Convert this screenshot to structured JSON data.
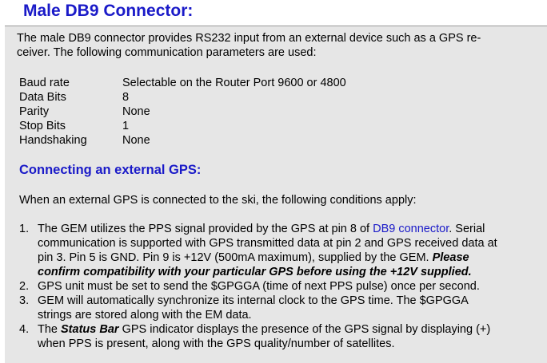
{
  "title": "Male DB9 Connector:",
  "intro": {
    "line1": "The male DB9 connector provides RS232 input from an external device such as a GPS re-",
    "line2": "ceiver. The following communication parameters are used:"
  },
  "parameters": [
    {
      "name": "Baud rate",
      "value": "Selectable on the Router Port 9600 or 4800"
    },
    {
      "name": "Data Bits",
      "value": "8"
    },
    {
      "name": "Parity",
      "value": "None"
    },
    {
      "name": "Stop Bits",
      "value": "1"
    },
    {
      "name": "Handshaking",
      "value": "None"
    }
  ],
  "section": {
    "heading": "Connecting an external GPS:",
    "conditions": "When an external GPS is connected to the ski, the following conditions apply:"
  },
  "items": [
    {
      "num": "1.",
      "l1a": "The GEM utilizes the PPS signal provided by the GPS at pin 8 of ",
      "l1link": "DB9 connector",
      "l1b": ". Serial",
      "l2": "communication is supported with GPS transmitted data at pin 2 and GPS received data at",
      "l3a": "pin 3. Pin 5 is GND.  Pin 9 is +12V (500mA maximum), supplied by the GEM.  ",
      "l3b": "Please",
      "l4": "confirm compatibility with your particular GPS before using the +12V supplied."
    },
    {
      "num": "2.",
      "l1": "GPS unit must be set to send the $GPGGA (time of next PPS pulse) once per second."
    },
    {
      "num": "3.",
      "l1": "GEM will automatically synchronize its internal clock to the GPS time. The $GPGGA",
      "l2": "strings are stored along with the EM data."
    },
    {
      "num": "4.",
      "l1a": "The ",
      "l1b": "Status Bar",
      "l1c": " GPS indicator displays the presence of the GPS signal by displaying (+)",
      "l2": "when PPS is present, along with the GPS quality/number of satellites."
    }
  ]
}
